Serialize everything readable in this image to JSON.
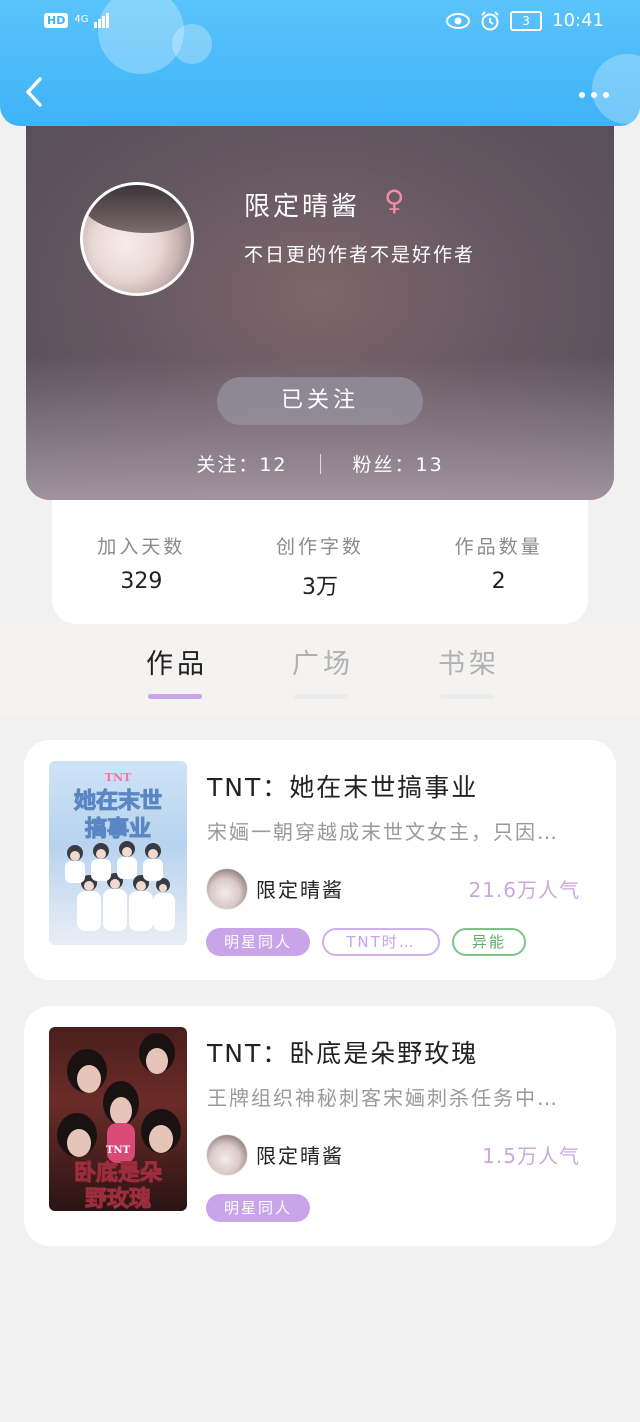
{
  "status_bar": {
    "hd": "HD",
    "network": "4G",
    "battery": "3",
    "time": "10:41"
  },
  "profile": {
    "username": "限定晴酱",
    "gender_symbol": "♀",
    "bio": "不日更的作者不是好作者",
    "follow_button": "已关注",
    "following": "关注：12",
    "fans": "粉丝：13"
  },
  "stats": [
    {
      "label": "加入天数",
      "value": "329"
    },
    {
      "label": "创作字数",
      "value": "3万"
    },
    {
      "label": "作品数量",
      "value": "2"
    }
  ],
  "tabs": [
    {
      "label": "作品",
      "active": true
    },
    {
      "label": "广场",
      "active": false
    },
    {
      "label": "书架",
      "active": false
    }
  ],
  "books": [
    {
      "title": "TNT：她在末世搞事业",
      "description": "宋婳一朝穿越成末世文女主，只因…",
      "author": "限定晴酱",
      "reads": "21.6万人气",
      "cover_title_line1": "她在末世",
      "cover_title_line2": "搞事业",
      "cover_badge": "TNT",
      "tags": [
        "明星同人",
        "TNT时…",
        "异能"
      ]
    },
    {
      "title": "TNT：卧底是朵野玫瑰",
      "description": "王牌组织神秘刺客宋婳刺杀任务中…",
      "author": "限定晴酱",
      "reads": "1.5万人气",
      "cover_title_line1": "卧底是朵",
      "cover_title_line2": "野玫瑰",
      "cover_badge": "TNT",
      "tags": [
        "明星同人"
      ]
    }
  ],
  "colors": {
    "accent_blue": "#3fb3f7",
    "accent_purple": "#c9a4e8",
    "tag_green": "#5bb066"
  },
  "icons": {
    "back": "chevron-left-icon",
    "more": "more-icon",
    "eye": "eye-icon",
    "alarm": "alarm-icon"
  }
}
